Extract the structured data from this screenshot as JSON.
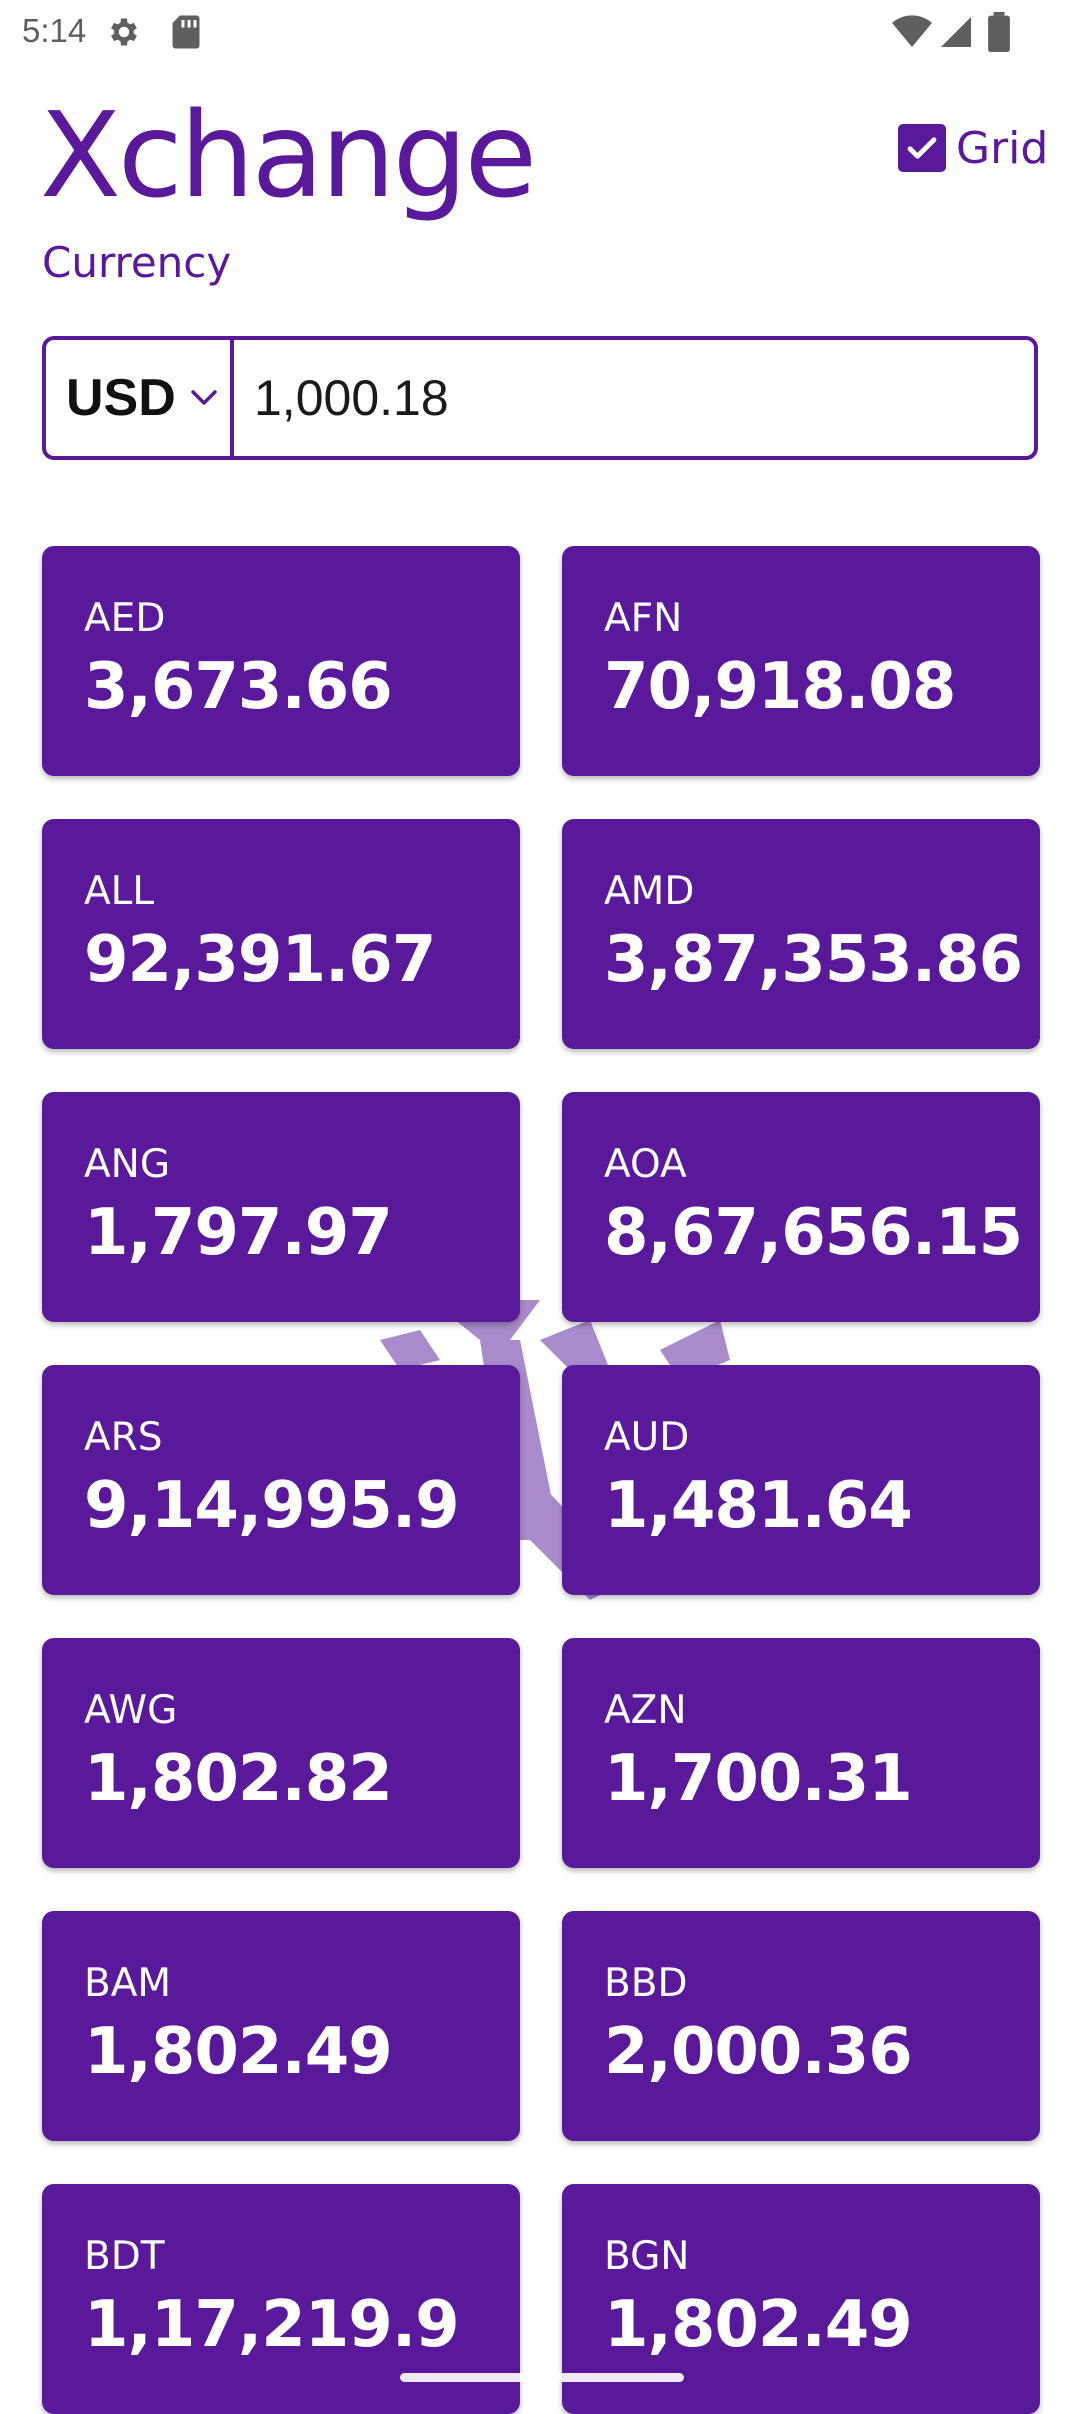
{
  "status_bar": {
    "time": "5:14",
    "icons": [
      "settings-icon",
      "sd-card-icon",
      "wifi-icon",
      "signal-icon",
      "battery-icon"
    ]
  },
  "header": {
    "title": "Xchange",
    "subtitle": "Currency",
    "grid_toggle": {
      "label": "Grid",
      "checked": true
    }
  },
  "converter": {
    "base_currency": "USD",
    "amount": "1,000.18"
  },
  "colors": {
    "primary": "#5a189a",
    "card_text": "#ffffff"
  },
  "rates": [
    {
      "code": "AED",
      "value": "3,673.66"
    },
    {
      "code": "AFN",
      "value": "70,918.08"
    },
    {
      "code": "ALL",
      "value": "92,391.67"
    },
    {
      "code": "AMD",
      "value": "3,87,353.86"
    },
    {
      "code": "ANG",
      "value": "1,797.97"
    },
    {
      "code": "AOA",
      "value": "8,67,656.15"
    },
    {
      "code": "ARS",
      "value": "9,14,995.9"
    },
    {
      "code": "AUD",
      "value": "1,481.64"
    },
    {
      "code": "AWG",
      "value": "1,802.82"
    },
    {
      "code": "AZN",
      "value": "1,700.31"
    },
    {
      "code": "BAM",
      "value": "1,802.49"
    },
    {
      "code": "BBD",
      "value": "2,000.36"
    },
    {
      "code": "BDT",
      "value": "1,17,219.9"
    },
    {
      "code": "BGN",
      "value": "1,802.49"
    }
  ]
}
